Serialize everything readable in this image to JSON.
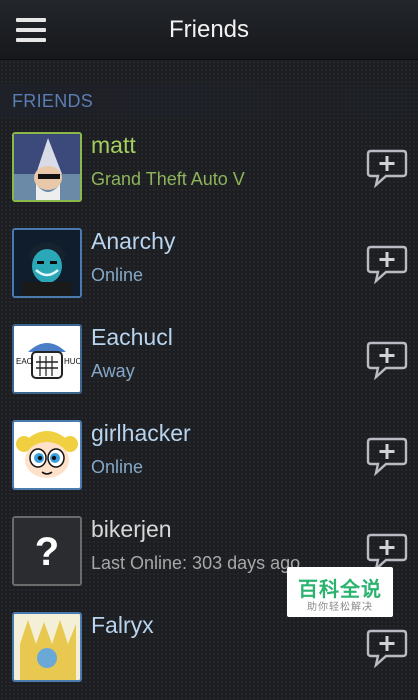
{
  "header": {
    "title": "Friends",
    "menu_icon": "hamburger-menu-icon"
  },
  "section": {
    "label": "FRIENDS"
  },
  "friends": [
    {
      "name": "matt",
      "status": "Grand Theft Auto V",
      "state": "ingame"
    },
    {
      "name": "Anarchy",
      "status": "Online",
      "state": "online"
    },
    {
      "name": "Eachucl",
      "status": "Away",
      "state": "away"
    },
    {
      "name": "girlhacker",
      "status": "Online",
      "state": "online"
    },
    {
      "name": "bikerjen",
      "status": "Last Online: 303 days ago",
      "state": "offline"
    },
    {
      "name": "Falryx",
      "status": "",
      "state": "online"
    }
  ],
  "avatar_placeholder": {
    "glyph": "?"
  },
  "watermark": {
    "main": "百科全说",
    "sub": "助你轻松解决"
  },
  "colors": {
    "ingame": "#a3cf5e",
    "online": "#b9d4ef",
    "offline": "#d8d8d8",
    "section_label": "#5a7db3"
  }
}
